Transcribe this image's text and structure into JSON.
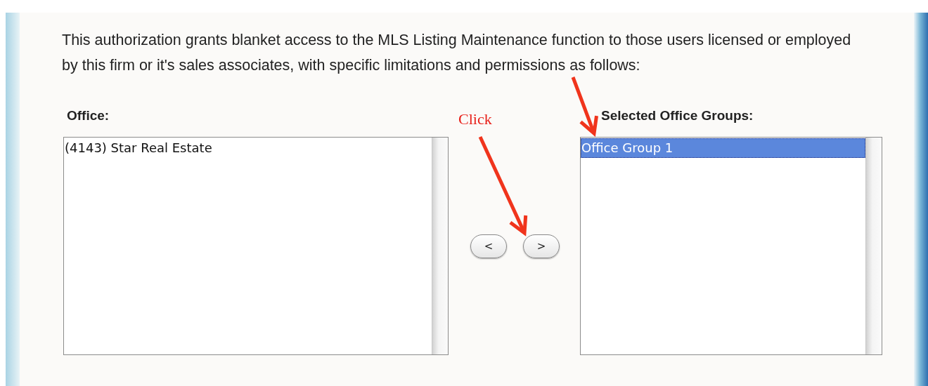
{
  "intro": "This authorization grants blanket access to the MLS Listing Maintenance function to those users licensed or employed by this firm or it's sales associates, with specific limitations and permissions as follows:",
  "office": {
    "label": "Office:",
    "items": [
      {
        "text": "(4143) Star Real Estate",
        "selected": false
      }
    ]
  },
  "move_buttons": [
    {
      "label": "<"
    },
    {
      "label": ">"
    }
  ],
  "selected_office_groups": {
    "label": "Selected Office Groups:",
    "items": [
      {
        "text": "Office Group 1",
        "selected": true
      }
    ]
  },
  "annotations": [
    {
      "kind": "arrow"
    },
    {
      "kind": "label",
      "text": "Click"
    },
    {
      "kind": "arrow"
    }
  ]
}
